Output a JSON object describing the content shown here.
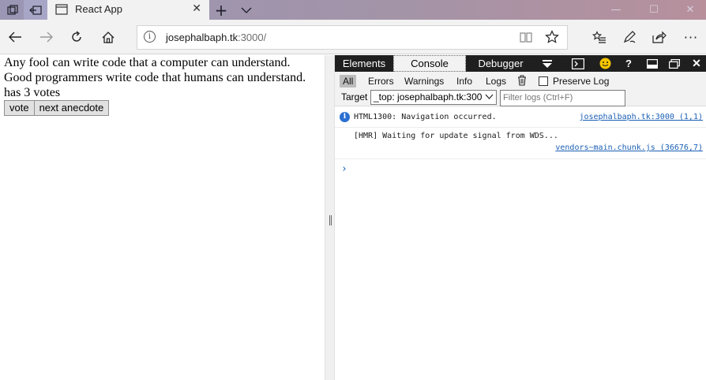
{
  "browser": {
    "tab_title": "React App",
    "url_host": "josephalbaph.tk",
    "url_rest": ":3000/"
  },
  "page": {
    "line1": "Any fool can write code that a computer can understand.",
    "line2": "Good programmers write code that humans can understand.",
    "votes": "has 3 votes",
    "vote_button": "vote",
    "next_button": "next anecdote"
  },
  "devtools": {
    "tabs": [
      "Elements",
      "Console",
      "Debugger"
    ],
    "filters": [
      "All",
      "Errors",
      "Warnings",
      "Info",
      "Logs"
    ],
    "preserve_log": "Preserve Log",
    "target_label": "Target",
    "target_value": "_top: josephalbaph.tk:300",
    "filter_placeholder": "Filter logs (Ctrl+F)",
    "messages": [
      {
        "text": "HTML1300: Navigation occurred.",
        "source": "josephalbaph.tk:3000 (1,1)"
      },
      {
        "text": "[HMR] Waiting for update signal from WDS...",
        "source": "vendors~main.chunk.js (36676,7)"
      }
    ],
    "prompt": "›"
  },
  "colors": {
    "titlebar_start": "#9a96b4",
    "titlebar_end": "#b7909c",
    "devtools_bar": "#1f1f1f",
    "link": "#1a5fb4"
  }
}
